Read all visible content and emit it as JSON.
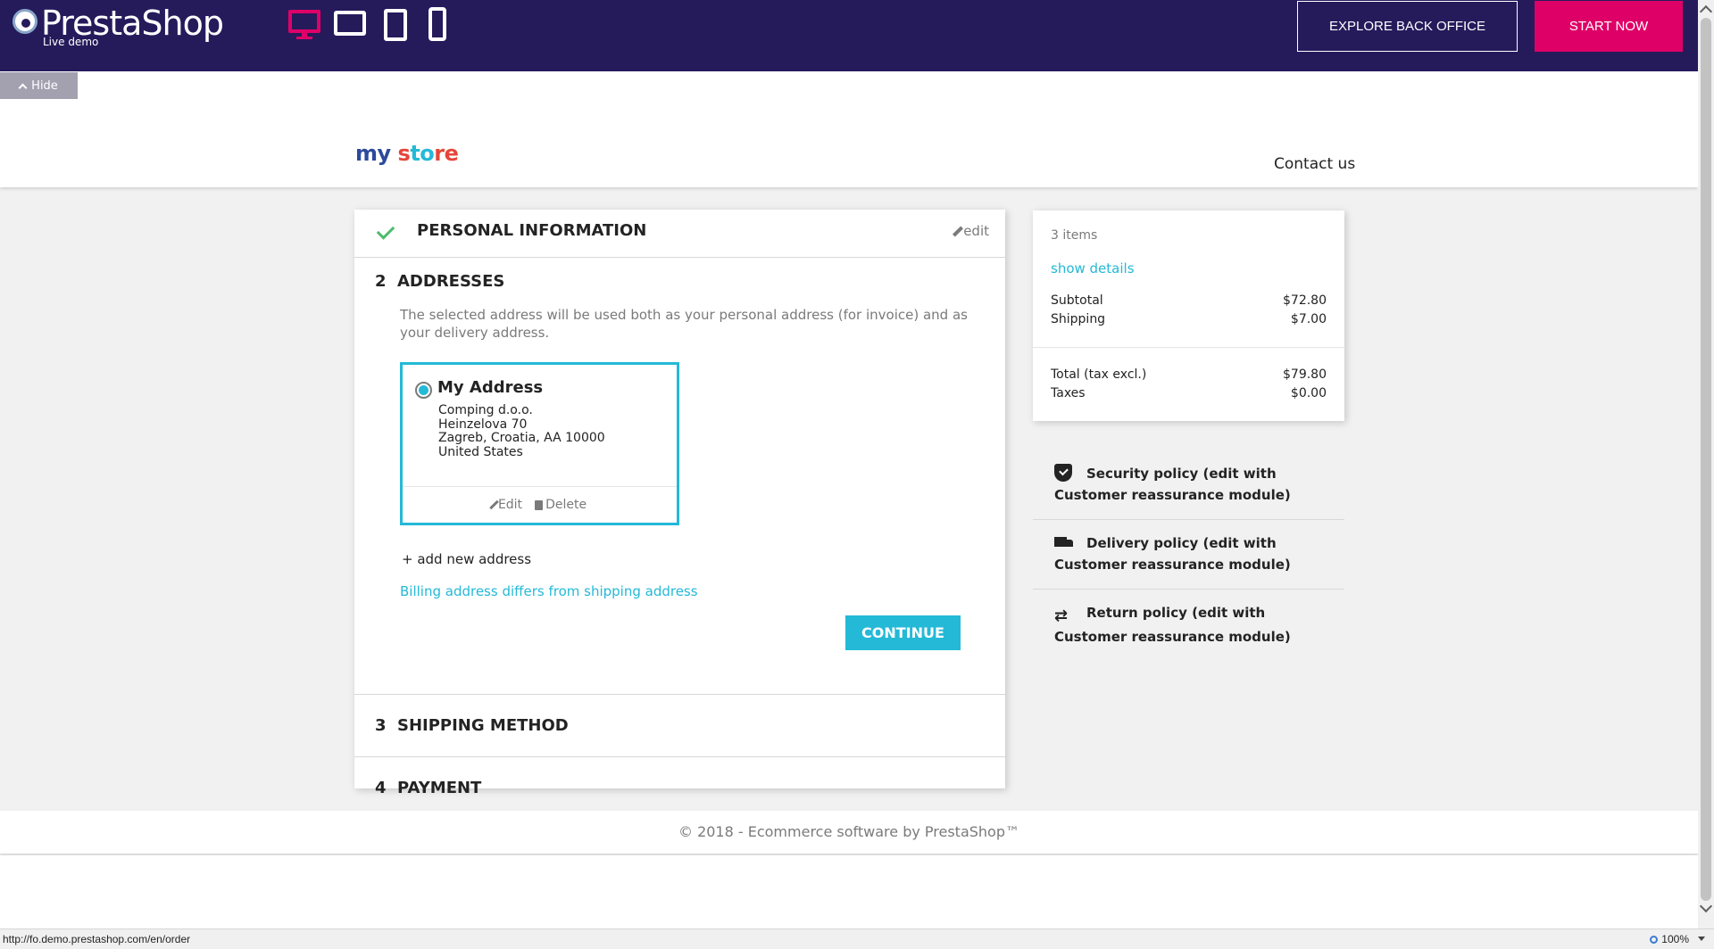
{
  "demo_bar": {
    "brand": "PrestaShop",
    "subtitle": "Live demo",
    "explore_label": "EXPLORE BACK OFFICE",
    "start_label": "START NOW",
    "hide_label": "Hide",
    "colors": {
      "bar": "#251b5b",
      "accent": "#df0067"
    }
  },
  "store": {
    "logo": {
      "w1": "my",
      "w2a": "s",
      "w2b": "to",
      "w2c": "re"
    },
    "contact_label": "Contact us"
  },
  "checkout": {
    "step1": {
      "title": "Personal Information",
      "edit_label": "edit"
    },
    "step2": {
      "number": "2",
      "title": "Addresses",
      "description": "The selected address will be used both as your personal address (for invoice) and as your delivery address.",
      "address": {
        "alias": "My Address",
        "line1": "Comping d.o.o.",
        "line2": "Heinzelova 70",
        "line3": "Zagreb, Croatia, AA 10000",
        "line4": "United States",
        "edit_label": "Edit",
        "delete_label": "Delete"
      },
      "add_address_label": "+ add new address",
      "billing_link": "Billing address differs from shipping address",
      "continue_label": "Continue"
    },
    "step3": {
      "number": "3",
      "title": "Shipping Method"
    },
    "step4": {
      "number": "4",
      "title": "Payment"
    },
    "colors": {
      "accent": "#24b9d7",
      "check": "#4cbb6c"
    }
  },
  "summary": {
    "items_count": "3 items",
    "show_details": "show details",
    "subtotal_label": "Subtotal",
    "subtotal_value": "$72.80",
    "shipping_label": "Shipping",
    "shipping_value": "$7.00",
    "total_label": "Total (tax excl.)",
    "total_value": "$79.80",
    "taxes_label": "Taxes",
    "taxes_value": "$0.00"
  },
  "reassurance": {
    "security": "Security policy (edit with Customer reassurance module)",
    "delivery": "Delivery policy (edit with Customer reassurance module)",
    "return": "Return policy (edit with Customer reassurance module)"
  },
  "footer": {
    "text": "© 2018 - Ecommerce software by PrestaShop™"
  },
  "status_bar": {
    "url": "http://fo.demo.prestashop.com/en/order",
    "zoom": "100%"
  }
}
